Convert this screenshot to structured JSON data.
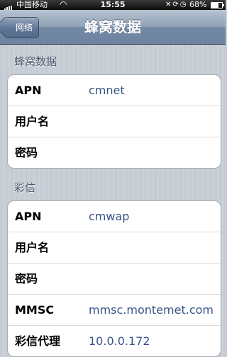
{
  "status_bar": {
    "carrier": "中国移动",
    "time": "15:55",
    "battery_percent": "68%",
    "battery_level": 0.68
  },
  "nav": {
    "back_label": "网络",
    "title": "蜂窝数据"
  },
  "cellular_data": {
    "header": "蜂窝数据",
    "rows": [
      {
        "label": "APN",
        "value": "cmnet"
      },
      {
        "label": "用户名",
        "value": ""
      },
      {
        "label": "密码",
        "value": ""
      }
    ]
  },
  "mms": {
    "header": "彩信",
    "rows": [
      {
        "label": "APN",
        "value": "cmwap"
      },
      {
        "label": "用户名",
        "value": ""
      },
      {
        "label": "密码",
        "value": ""
      },
      {
        "label": "MMSC",
        "value": "mmsc.montemet.com"
      },
      {
        "label": "彩信代理",
        "value": "10.0.0.172"
      }
    ]
  },
  "colors": {
    "value_text": "#385487",
    "section_header": "#4c566c",
    "background": "#c5ccd4"
  }
}
